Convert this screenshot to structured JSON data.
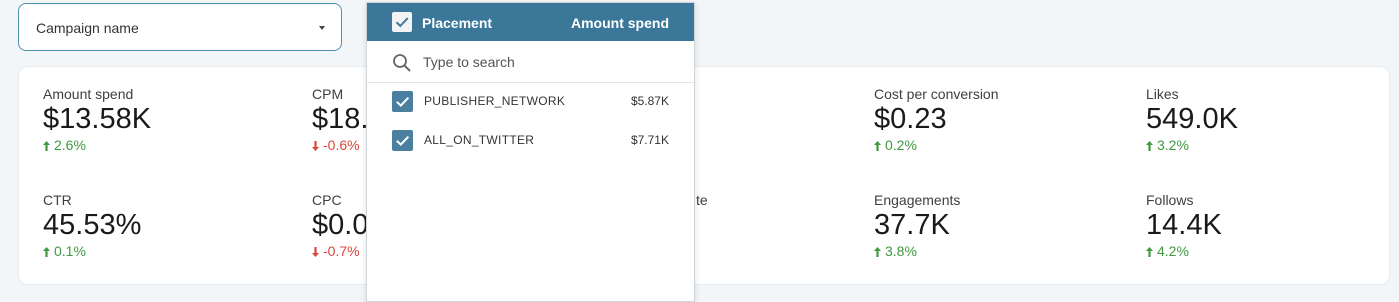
{
  "campaign_filter": {
    "label": "Campaign name"
  },
  "placement_dropdown": {
    "header": {
      "title": "Placement",
      "amount_header": "Amount spend"
    },
    "search": {
      "placeholder": "Type to search",
      "value": ""
    },
    "items": [
      {
        "name": "PUBLISHER_NETWORK",
        "amount": "$5.87K",
        "checked": true
      },
      {
        "name": "ALL_ON_TWITTER",
        "amount": "$7.71K",
        "checked": true
      }
    ]
  },
  "metrics": {
    "amount_spend": {
      "label": "Amount spend",
      "value": "$13.58K",
      "delta": "2.6%",
      "direction": "up"
    },
    "cpm": {
      "label": "CPM",
      "value": "$18.",
      "delta": "-0.6%",
      "direction": "down"
    },
    "cost_per_conversion": {
      "label": "Cost per conversion",
      "value": "$0.23",
      "delta": "0.2%",
      "direction": "up"
    },
    "likes": {
      "label": "Likes",
      "value": "549.0K",
      "delta": "3.2%",
      "direction": "up"
    },
    "ctr": {
      "label": "CTR",
      "value": "45.53%",
      "delta": "0.1%",
      "direction": "up"
    },
    "cpc": {
      "label": "CPC",
      "value": "$0.0",
      "delta": "-0.7%",
      "direction": "down"
    },
    "engagement_rate_partial": {
      "label": "te",
      "value": ""
    },
    "engagements": {
      "label": "Engagements",
      "value": "37.7K",
      "delta": "3.8%",
      "direction": "up"
    },
    "follows": {
      "label": "Follows",
      "value": "14.4K",
      "delta": "4.2%",
      "direction": "up"
    }
  },
  "colors": {
    "header_bg": "#3b7799",
    "checkbox": "#4a7fa0",
    "positive": "#3f9a3f",
    "negative": "#d9473b",
    "page_bg": "#f3f6f8"
  },
  "icons": [
    "chevron-down-icon",
    "search-icon",
    "checkbox-checked-icon",
    "arrow-up-icon",
    "arrow-down-icon"
  ]
}
